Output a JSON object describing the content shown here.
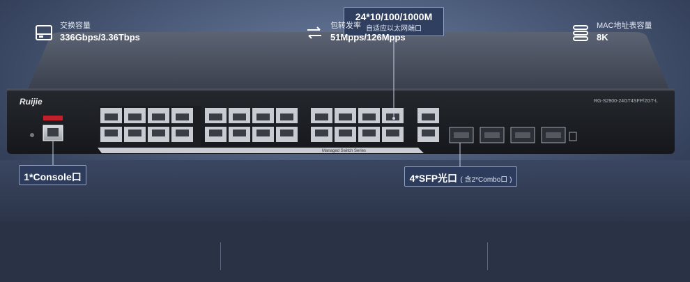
{
  "callouts": {
    "top_main": "24*10/100/1000M",
    "top_sub": "自适应以太网端口",
    "console_main": "1*Console口",
    "sfp_main": "4*SFP光口",
    "sfp_sub": "( 含2*Combo口 )"
  },
  "device": {
    "brand": "Ruijie",
    "model": "RG-S2900-24GT4SFP/2GT-L",
    "series": "Managed Switch Series"
  },
  "stats": [
    {
      "label": "交换容量",
      "value": "336Gbps/3.36Tbps",
      "icon": "storage-icon"
    },
    {
      "label": "包转发率",
      "value": "51Mpps/126Mpps",
      "icon": "exchange-arrows-icon"
    },
    {
      "label": "MAC地址表容量",
      "value": "8K",
      "icon": "database-icon"
    }
  ],
  "colors": {
    "panel_bg": "#2a3346",
    "callout_bg": "#2d3c5c"
  }
}
